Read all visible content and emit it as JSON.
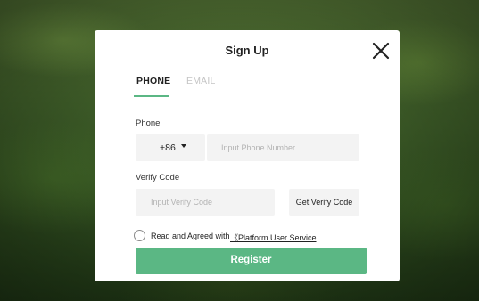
{
  "modal": {
    "title": "Sign Up",
    "close_icon": "close-icon"
  },
  "tabs": [
    {
      "label": "PHONE",
      "active": true
    },
    {
      "label": "EMAIL",
      "active": false
    }
  ],
  "phone": {
    "label": "Phone",
    "country_code": "+86",
    "placeholder": "Input Phone Number"
  },
  "verify": {
    "label": "Verify Code",
    "placeholder": "Input Verify Code",
    "button_label": "Get Verify Code"
  },
  "agreement": {
    "checked": false,
    "text": "Read and Agreed with",
    "link_text": "《Platform User Service"
  },
  "register": {
    "label": "Register"
  },
  "colors": {
    "accent": "#5bb784",
    "field_background": "#f3f3f3",
    "inactive_tab": "#c4c4c4"
  }
}
